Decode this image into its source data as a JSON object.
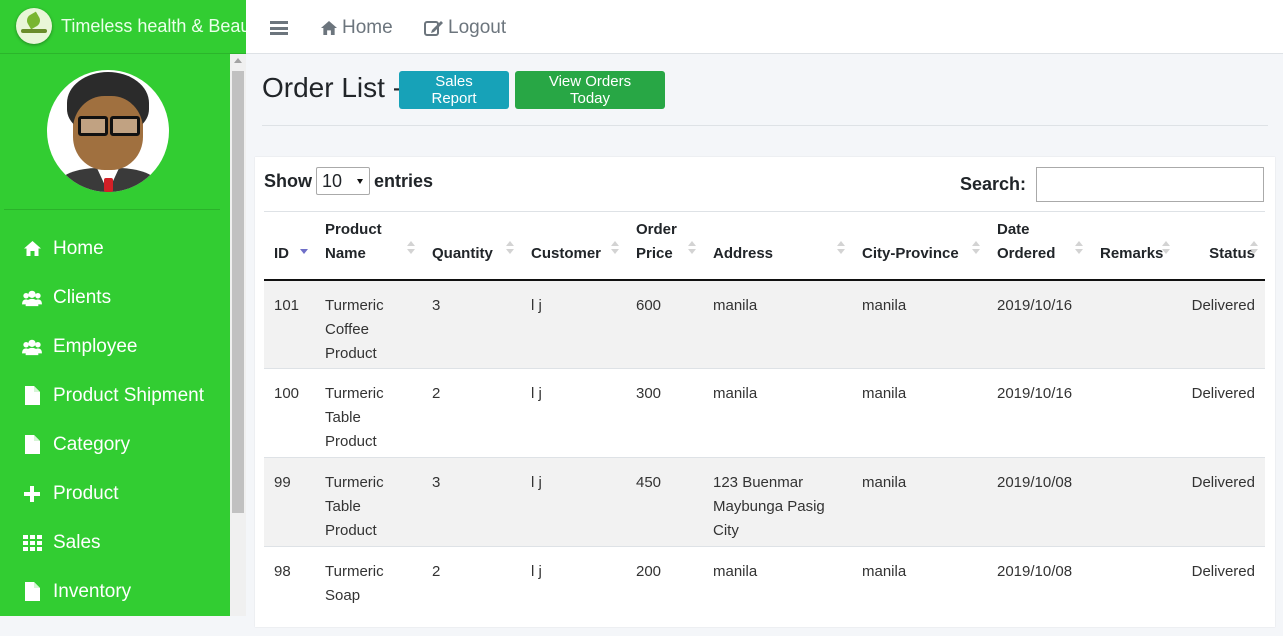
{
  "app": {
    "brand_title": "Timeless health & Beauty"
  },
  "sidebar": {
    "items": [
      {
        "label": "Home",
        "icon": "home-icon"
      },
      {
        "label": "Clients",
        "icon": "users-icon"
      },
      {
        "label": "Employee",
        "icon": "users-icon"
      },
      {
        "label": "Product Shipment",
        "icon": "file-icon"
      },
      {
        "label": "Category",
        "icon": "file-icon"
      },
      {
        "label": "Product",
        "icon": "plus-icon"
      },
      {
        "label": "Sales",
        "icon": "grid-icon"
      },
      {
        "label": "Inventory",
        "icon": "file-icon"
      }
    ]
  },
  "topbar": {
    "home_label": "Home",
    "logout_label": "Logout"
  },
  "page": {
    "title": "Order List -",
    "sales_report_label": "Sales Report",
    "view_orders_today_label": "View Orders Today"
  },
  "table_controls": {
    "show_label": "Show",
    "entries_value": "10",
    "entries_label": "entries",
    "search_label": "Search:",
    "search_value": ""
  },
  "table": {
    "columns": [
      "ID",
      "Product Name",
      "Quantity",
      "Customer",
      "Order Price",
      "Address",
      "City-Province",
      "Date Ordered",
      "Remarks",
      "Status"
    ],
    "rows": [
      {
        "id": "101",
        "product": "Turmeric Coffee Product",
        "quantity": "3",
        "customer": "l j",
        "price": "600",
        "address": "manila",
        "city": "manila",
        "date": "2019/10/16",
        "remarks": "",
        "status": "Delivered"
      },
      {
        "id": "100",
        "product": "Turmeric Table Product",
        "quantity": "2",
        "customer": "l j",
        "price": "300",
        "address": "manila",
        "city": "manila",
        "date": "2019/10/16",
        "remarks": "",
        "status": "Delivered"
      },
      {
        "id": "99",
        "product": "Turmeric Table Product",
        "quantity": "3",
        "customer": "l j",
        "price": "450",
        "address": "123 Buenmar Maybunga Pasig City",
        "city": "manila",
        "date": "2019/10/08",
        "remarks": "",
        "status": "Delivered"
      },
      {
        "id": "98",
        "product": "Turmeric Soap",
        "quantity": "2",
        "customer": "l j",
        "price": "200",
        "address": "manila",
        "city": "manila",
        "date": "2019/10/08",
        "remarks": "",
        "status": "Delivered"
      }
    ]
  },
  "colors": {
    "sidebar": "#32cd32",
    "info_button": "#17a2b8",
    "success_button": "#28a745"
  }
}
